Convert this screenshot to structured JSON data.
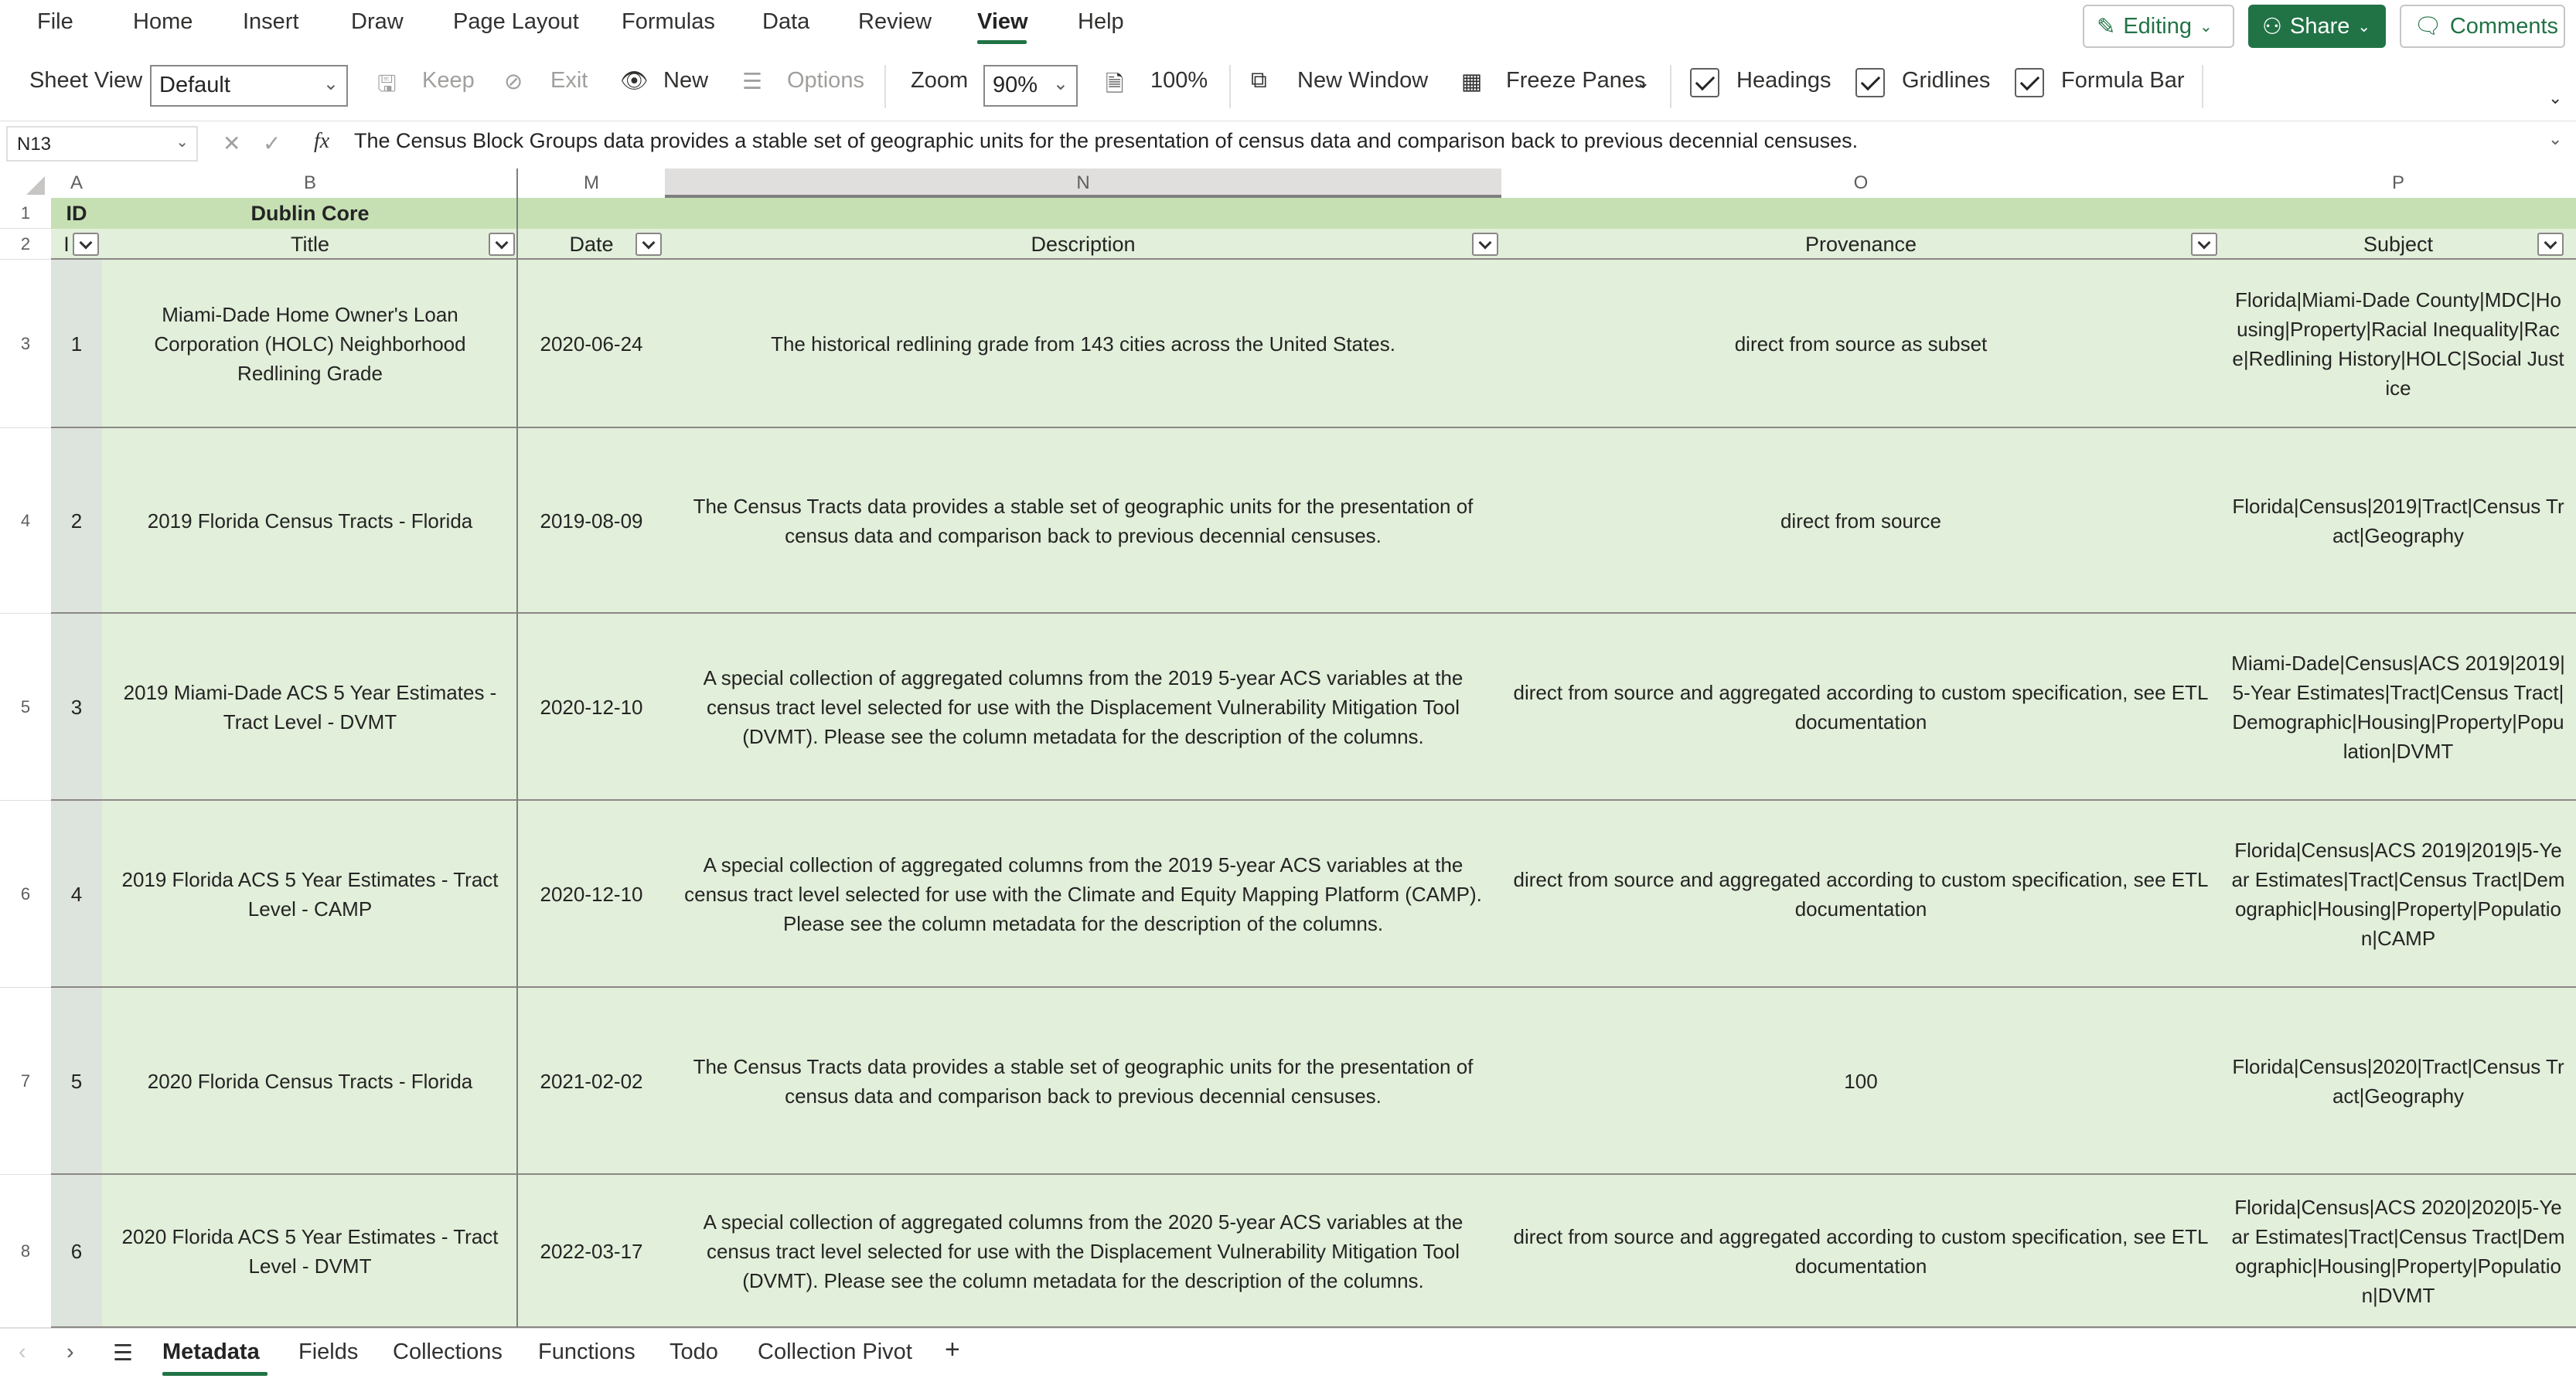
{
  "menu": {
    "items": [
      "File",
      "Home",
      "Insert",
      "Draw",
      "Page Layout",
      "Formulas",
      "Data",
      "Review",
      "View",
      "Help"
    ],
    "active": "View",
    "editing_label": "Editing",
    "share_label": "Share",
    "comments_label": "Comments"
  },
  "ribbon": {
    "sheet_view_label": "Sheet View",
    "sheet_view_value": "Default",
    "keep_label": "Keep",
    "exit_label": "Exit",
    "new_label": "New",
    "options_label": "Options",
    "zoom_label": "Zoom",
    "zoom_value": "90%",
    "hundred_label": "100%",
    "new_window_label": "New Window",
    "freeze_panes_label": "Freeze Panes",
    "headings_label": "Headings",
    "gridlines_label": "Gridlines",
    "formula_bar_label": "Formula Bar"
  },
  "formula_bar": {
    "name_box": "N13",
    "fx": "fx",
    "content": "The Census Block Groups data provides a stable set of geographic units for the presentation of census data and comparison back to previous decennial censuses."
  },
  "columns": {
    "A": "A",
    "B": "B",
    "M": "M",
    "N": "N",
    "O": "O",
    "P": "P"
  },
  "header_rows": {
    "row1_id": "ID",
    "row1_group": "Dublin Core",
    "row2_id": "I",
    "title": "Title",
    "date": "Date",
    "description": "Description",
    "provenance": "Provenance",
    "subject": "Subject"
  },
  "rows": [
    {
      "row": "3",
      "id": "1",
      "title": "Miami-Dade Home Owner's Loan Corporation (HOLC) Neighborhood Redlining Grade",
      "date": "2020-06-24",
      "description": "The historical redlining grade from 143 cities across the United States.",
      "provenance": "direct from source as subset",
      "subject": "Florida|Miami-Dade County|MDC|Housing|Property|Racial Inequality|Race|Redlining History|HOLC|Social Justice"
    },
    {
      "row": "4",
      "id": "2",
      "title": "2019 Florida Census Tracts - Florida",
      "date": "2019-08-09",
      "description": "The Census Tracts data provides a stable set of geographic units for the presentation of census data and comparison back to previous decennial censuses.",
      "provenance": "direct from source",
      "subject": "Florida|Census|2019|Tract|Census Tract|Geography"
    },
    {
      "row": "5",
      "id": "3",
      "title": "2019 Miami-Dade ACS 5 Year Estimates - Tract Level - DVMT",
      "date": "2020-12-10",
      "description": "A special collection of aggregated columns from the 2019 5-year ACS variables at the census tract level selected for use with the Displacement Vulnerability Mitigation Tool (DVMT). Please see the column metadata for the description of the columns.",
      "provenance": "direct from source and aggregated according to custom specification, see ETL documentation",
      "subject": "Miami-Dade|Census|ACS 2019|2019|5-Year Estimates|Tract|Census Tract|Demographic|Housing|Property|Population|DVMT"
    },
    {
      "row": "6",
      "id": "4",
      "title": "2019 Florida ACS 5 Year Estimates - Tract Level - CAMP",
      "date": "2020-12-10",
      "description": "A special collection of aggregated columns from the 2019 5-year ACS variables at the census tract level selected for use with the Climate and Equity Mapping Platform (CAMP). Please see the column metadata for the description of the columns.",
      "provenance": "direct from source and aggregated according to custom specification, see ETL documentation",
      "subject": "Florida|Census|ACS 2019|2019|5-Year Estimates|Tract|Census Tract|Demographic|Housing|Property|Population|CAMP"
    },
    {
      "row": "7",
      "id": "5",
      "title": "2020 Florida Census Tracts - Florida",
      "date": "2021-02-02",
      "description": "The Census Tracts data provides a stable set of geographic units for the presentation of census data and comparison back to previous decennial censuses.",
      "provenance": "100",
      "subject": "Florida|Census|2020|Tract|Census Tract|Geography"
    },
    {
      "row": "8",
      "id": "6",
      "title": "2020 Florida ACS 5 Year Estimates - Tract Level - DVMT",
      "date": "2022-03-17",
      "description": "A special collection of aggregated columns from the 2020 5-year ACS variables at the census tract level selected for use with the Displacement Vulnerability Mitigation Tool (DVMT). Please see the column metadata for the description of the columns.",
      "provenance": "direct from source and aggregated according to custom specification, see ETL documentation",
      "subject": "Florida|Census|ACS 2020|2020|5-Year Estimates|Tract|Census Tract|Demographic|Housing|Property|Population|DVMT"
    }
  ],
  "sheet_tabs": [
    "Metadata",
    "Fields",
    "Collections",
    "Functions",
    "Todo",
    "Collection Pivot"
  ],
  "active_tab": "Metadata",
  "add_sheet": "+",
  "colors": {
    "accent": "#217346",
    "band": "#e2efda",
    "header_band": "#c6e0b4"
  }
}
